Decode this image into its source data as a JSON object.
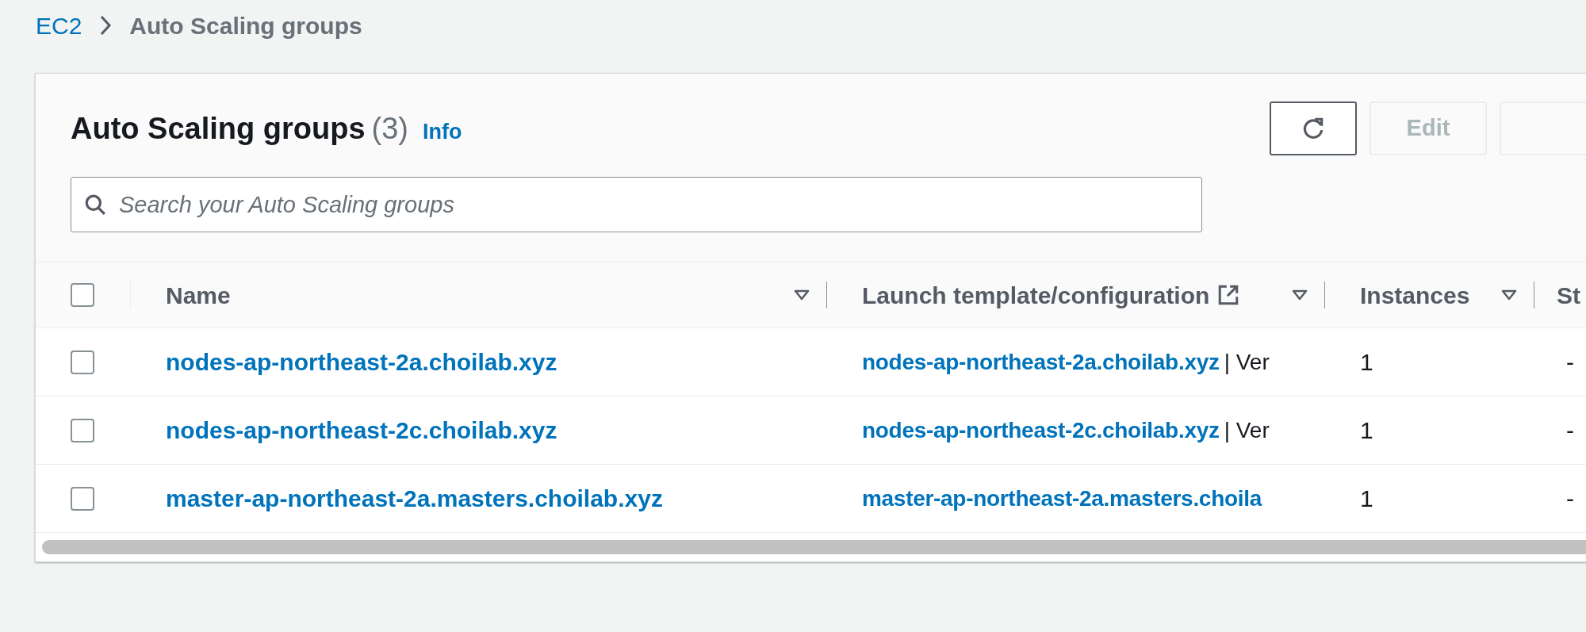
{
  "breadcrumb": [
    {
      "kind": "link",
      "label": "EC2"
    },
    {
      "kind": "current",
      "label": "Auto Scaling groups"
    }
  ],
  "panel": {
    "title": "Auto Scaling groups",
    "count": "(3)",
    "info": "Info",
    "buttons": [
      {
        "kind": "refresh",
        "disabled": false
      },
      {
        "kind": "text",
        "label": "Edit",
        "disabled": true
      },
      {
        "kind": "blank",
        "disabled": true
      }
    ]
  },
  "search": {
    "placeholder": "Search your Auto Scaling groups"
  },
  "table": {
    "select_all": {
      "checked": false
    },
    "columns": [
      {
        "kind": "sortable",
        "label": "Name"
      },
      {
        "kind": "external_sortable",
        "label": "Launch template/configuration"
      },
      {
        "kind": "sortable",
        "label": "Instances"
      },
      {
        "kind": "plain",
        "label": "St"
      }
    ],
    "rows": [
      {
        "checked": false,
        "name": "nodes-ap-northeast-2a.choilab.xyz",
        "template": "nodes-ap-northeast-2a.choilab.xyz",
        "template_suffix": "| Ver",
        "instances": "1",
        "column_4": "-"
      },
      {
        "checked": false,
        "name": "nodes-ap-northeast-2c.choilab.xyz",
        "template": "nodes-ap-northeast-2c.choilab.xyz",
        "template_suffix": "| Ver",
        "instances": "1",
        "column_4": "-"
      },
      {
        "checked": false,
        "name": "master-ap-northeast-2a.masters.choilab.xyz",
        "template": "master-ap-northeast-2a.masters.choila",
        "instances": "1",
        "column_4": "-"
      }
    ]
  }
}
